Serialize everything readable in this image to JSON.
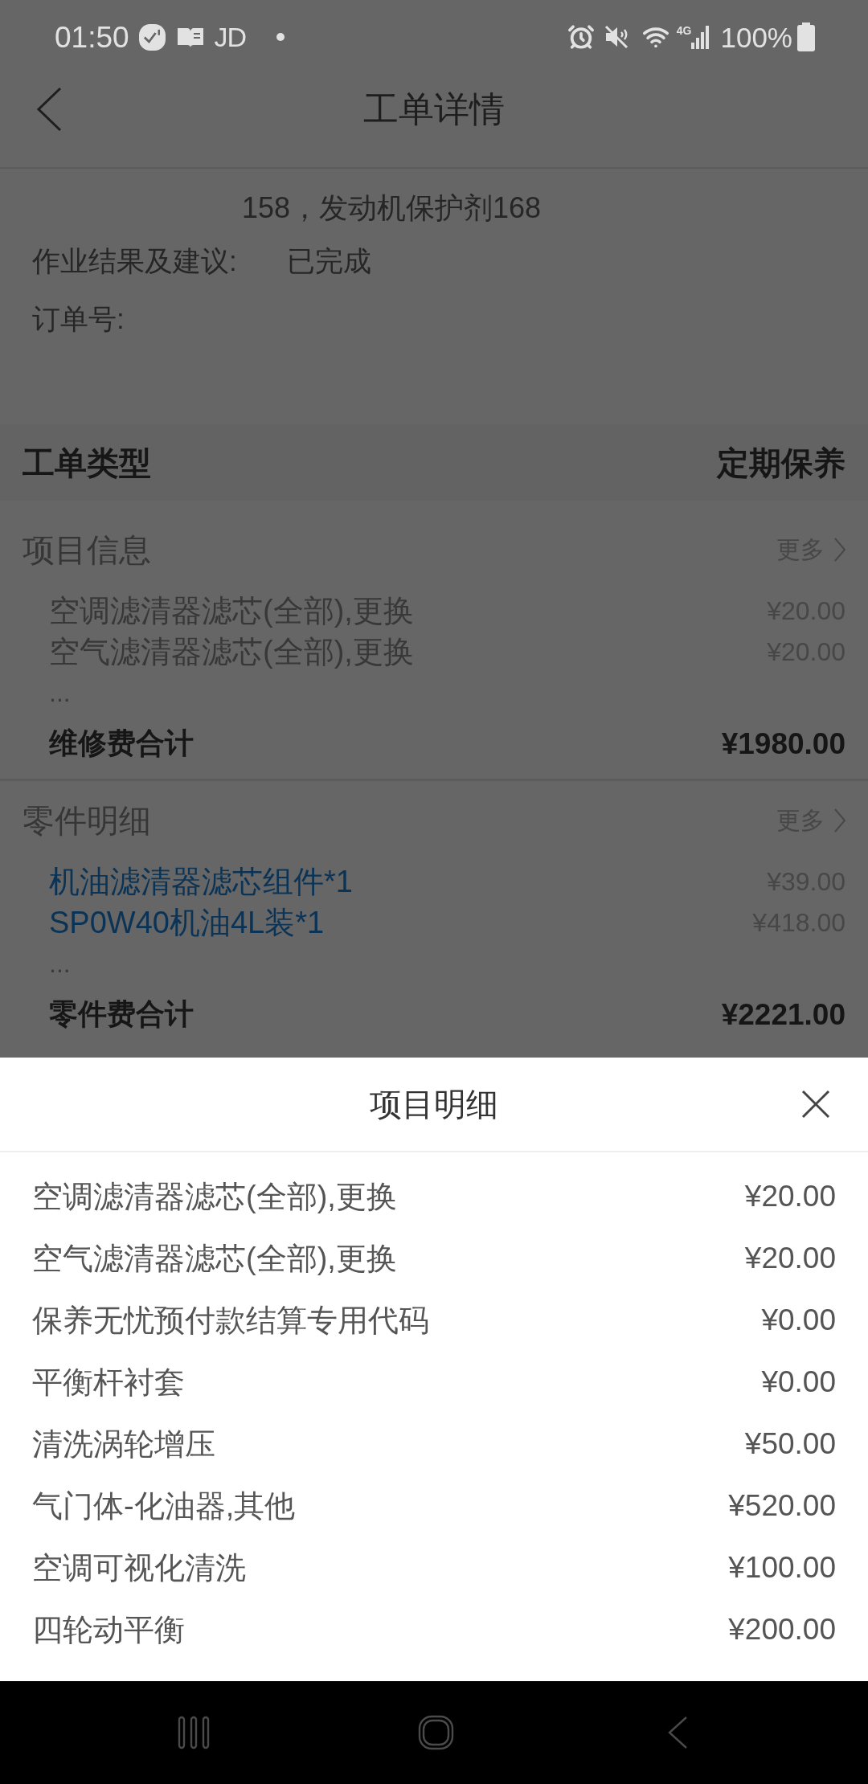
{
  "status_bar": {
    "time": "01:50",
    "notification_text": "JD",
    "network_type": "4G",
    "battery": "100%"
  },
  "header": {
    "title": "工单详情"
  },
  "details": {
    "continuation": "158，发动机保护剂168",
    "fields": [
      {
        "label": "作业结果及建议:",
        "value": "已完成"
      },
      {
        "label": "订单号:"
      }
    ]
  },
  "order_type": {
    "label": "工单类型",
    "value": "定期保养"
  },
  "sections": [
    {
      "kind": "service",
      "title": "项目信息",
      "more": "更多",
      "items": [
        {
          "name": "空调滤清器滤芯(全部),更换",
          "price": "¥20.00"
        },
        {
          "name": "空气滤清器滤芯(全部),更换",
          "price": "¥20.00"
        }
      ],
      "ellipsis": "...",
      "total_label": "维修费合计",
      "total": "¥1980.00"
    },
    {
      "kind": "part",
      "title": "零件明细",
      "more": "更多",
      "items": [
        {
          "name": "机油滤清器滤芯组件*1",
          "price": "¥39.00"
        },
        {
          "name": "SP0W40机油4L装*1",
          "price": "¥418.00"
        }
      ],
      "ellipsis": "...",
      "total_label": "零件费合计",
      "total": "¥2221.00"
    }
  ],
  "sheet": {
    "title": "项目明细",
    "rows": [
      {
        "name": "空调滤清器滤芯(全部),更换",
        "price": "¥20.00"
      },
      {
        "name": "空气滤清器滤芯(全部),更换",
        "price": "¥20.00"
      },
      {
        "name": "保养无忧预付款结算专用代码",
        "price": "¥0.00"
      },
      {
        "name": "平衡杆衬套",
        "price": "¥0.00"
      },
      {
        "name": "清洗涡轮增压",
        "price": "¥50.00"
      },
      {
        "name": "气门体-化油器,其他",
        "price": "¥520.00"
      },
      {
        "name": "空调可视化清洗",
        "price": "¥100.00"
      },
      {
        "name": "四轮动平衡",
        "price": "¥200.00"
      }
    ]
  }
}
